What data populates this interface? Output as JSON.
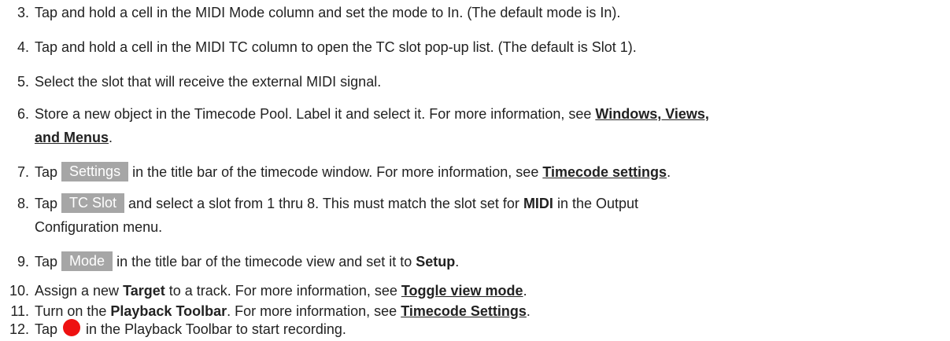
{
  "steps": [
    {
      "num": "3.",
      "text": "Tap and hold a cell in the MIDI Mode column and set the mode to In. (The default mode is In)."
    },
    {
      "num": "4.",
      "text": "Tap and hold a cell in the MIDI TC column to open the TC slot pop-up list. (The default is Slot 1)."
    },
    {
      "num": "5.",
      "text": "Select the slot that will receive the external MIDI signal."
    },
    {
      "num": "6.",
      "pre": "Store a new object in the Timecode Pool. Label it and select it. For more information, see ",
      "link1": "Windows, Views,",
      "link2": "and Menus",
      "post": "."
    },
    {
      "num": "7.",
      "pre": "Tap ",
      "button": "Settings",
      "mid": " in the title bar of the timecode window. For more information, see ",
      "link": "Timecode settings",
      "post": "."
    },
    {
      "num": "8.",
      "pre": "Tap ",
      "button": "TC Slot",
      "mid": " and select a slot from 1 thru 8. This must match the slot set for ",
      "bold": "MIDI",
      "post": " in the Output",
      "line2": "Configuration menu."
    },
    {
      "num": "9.",
      "pre": "Tap ",
      "button": "Mode",
      "mid": " in the title bar of the timecode view and set it to ",
      "bold": "Setup",
      "post": "."
    },
    {
      "num": "10.",
      "pre": "Assign a new ",
      "bold": "Target",
      "mid": " to a track. For more information, see ",
      "link": "Toggle view mode",
      "post": "."
    },
    {
      "num": "11.",
      "pre": "Turn on the ",
      "bold": "Playback Toolbar",
      "mid": ". For more information, see ",
      "link": "Timecode Settings",
      "post": "."
    },
    {
      "num": "12.",
      "pre": "Tap ",
      "icon": "record-icon",
      "post": " in the Playback Toolbar to start recording."
    }
  ],
  "colors": {
    "text": "#222222",
    "button_bg": "#a6a6a6",
    "button_text": "#ffffff",
    "record": "#ee1111"
  }
}
